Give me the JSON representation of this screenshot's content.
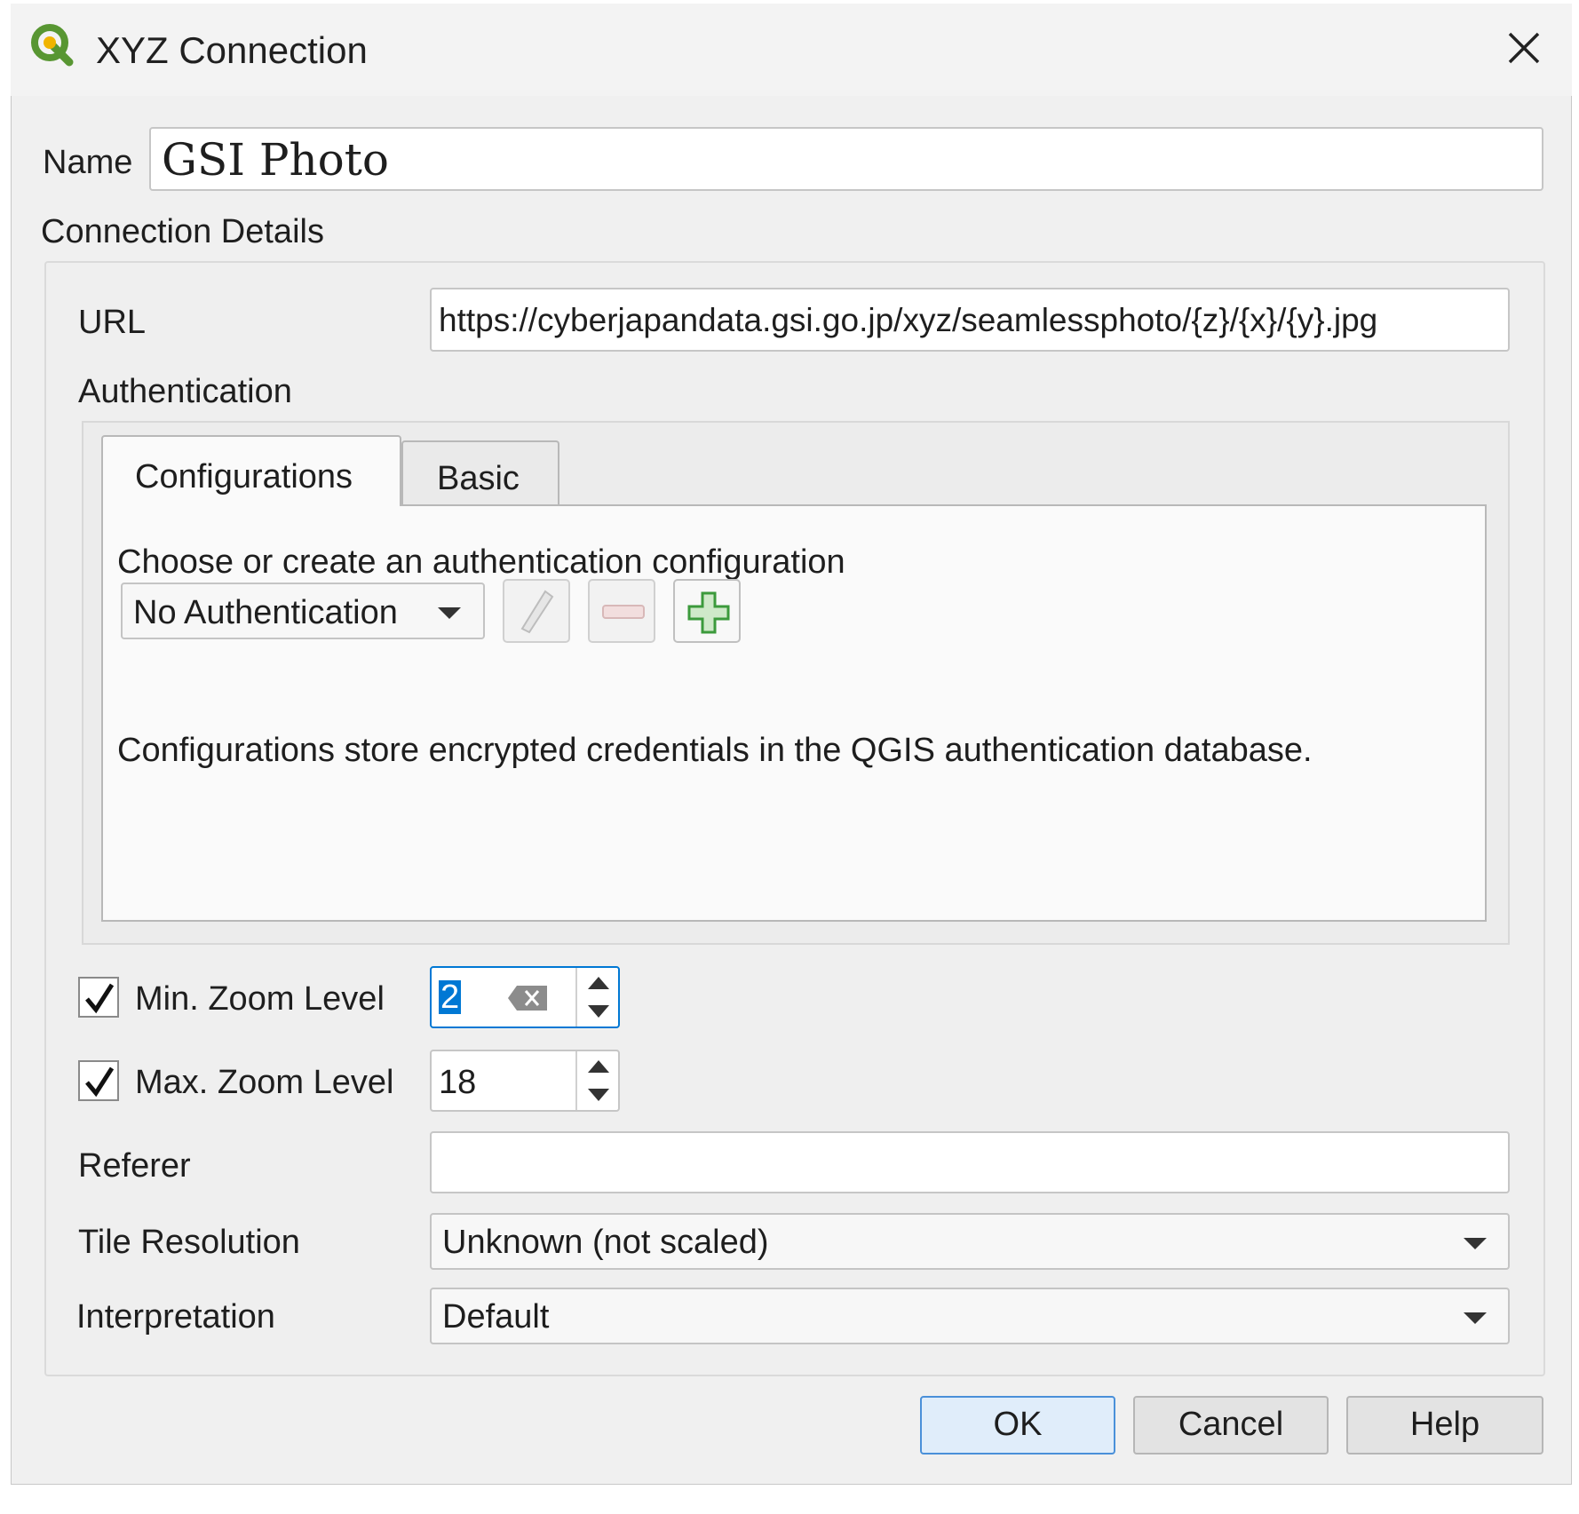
{
  "window": {
    "title": "XYZ Connection"
  },
  "name": {
    "label": "Name",
    "value": "GSI Photo"
  },
  "connection_details": {
    "heading": "Connection Details",
    "url_label": "URL",
    "url_value": "https://cyberjapandata.gsi.go.jp/xyz/seamlessphoto/{z}/{x}/{y}.jpg",
    "authentication_label": "Authentication"
  },
  "auth": {
    "tabs": [
      "Configurations",
      "Basic"
    ],
    "active_tab": "Configurations",
    "prompt": "Choose or create an authentication configuration",
    "selected": "No Authentication",
    "info": "Configurations store encrypted credentials in the QGIS authentication database."
  },
  "zoom": {
    "min_label": "Min. Zoom Level",
    "min_value": "2",
    "min_checked": true,
    "max_label": "Max. Zoom Level",
    "max_value": "18",
    "max_checked": true
  },
  "referer": {
    "label": "Referer",
    "value": ""
  },
  "tile_resolution": {
    "label": "Tile Resolution",
    "value": "Unknown (not scaled)"
  },
  "interpretation": {
    "label": "Interpretation",
    "value": "Default"
  },
  "buttons": {
    "ok": "OK",
    "cancel": "Cancel",
    "help": "Help"
  },
  "colors": {
    "accent": "#0078d4",
    "qgis_green": "#589632",
    "qgis_yellow": "#f0b400",
    "add_green": "#3c9a3c"
  },
  "icons": [
    "qgis-logo-icon",
    "close-icon",
    "pencil-icon",
    "minus-icon",
    "plus-icon",
    "chevron-down-icon",
    "checkmark-icon",
    "clear-icon",
    "spin-up-icon",
    "spin-down-icon"
  ]
}
